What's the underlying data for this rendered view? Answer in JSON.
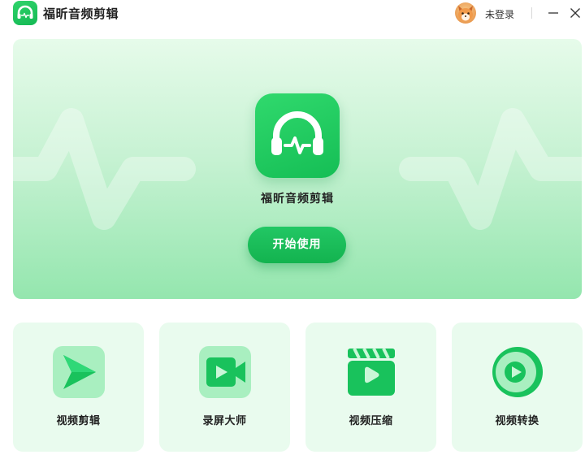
{
  "titlebar": {
    "app_title": "福昕音频剪辑",
    "login_label": "未登录",
    "logo_icon": "headphones-pulse-icon",
    "avatar_icon": "fox-avatar-icon"
  },
  "hero": {
    "app_name": "福昕音频剪辑",
    "start_label": "开始使用",
    "logo_icon": "headphones-pulse-icon"
  },
  "tools": [
    {
      "label": "视频剪辑",
      "icon": "play-arrow-icon"
    },
    {
      "label": "录屏大师",
      "icon": "video-camera-icon"
    },
    {
      "label": "视频压缩",
      "icon": "clapperboard-icon"
    },
    {
      "label": "视频转换",
      "icon": "play-circle-icon"
    }
  ],
  "colors": {
    "brand_green": "#18c05a",
    "hero_top": "#e6fbea",
    "hero_bottom": "#94e6ae",
    "card_bg": "#e9fbee"
  }
}
